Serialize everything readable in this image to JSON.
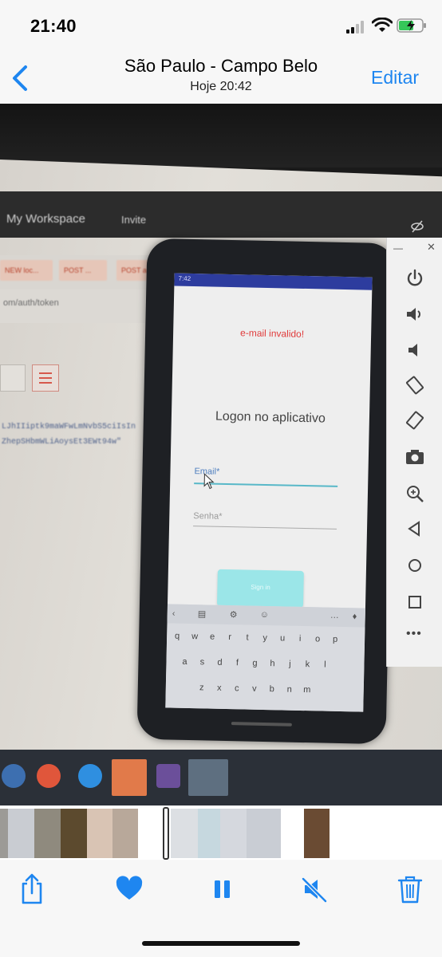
{
  "status_bar": {
    "time": "21:40"
  },
  "nav": {
    "title": "São Paulo - Campo Belo",
    "subtitle": "Hoje  20:42",
    "edit_label": "Editar"
  },
  "photo": {
    "postman": {
      "workspace_label": "My Workspace",
      "invite_label": "Invite",
      "tabs": [
        "NEW loc...",
        "POST ...",
        "POST a..."
      ],
      "url_text": "om/auth/token",
      "token_line_1": "LJhIIiptk9maWFwLmNvbS5ciIsIn",
      "token_line_2": "ZhepSHbmWLiAoysEt3EWt94w\""
    },
    "emulator_app": {
      "status_time": "7:42",
      "error_message": "e-mail invalido!",
      "heading": "Logon no aplicativo",
      "email_label": "Email*",
      "password_label": "Senha*",
      "signin_label": "Sign in",
      "keyboard_rows": [
        [
          "q",
          "w",
          "e",
          "r",
          "t",
          "y",
          "u",
          "i",
          "o",
          "p"
        ],
        [
          "a",
          "s",
          "d",
          "f",
          "g",
          "h",
          "j",
          "k",
          "l"
        ],
        [
          "z",
          "x",
          "c",
          "v",
          "b",
          "n",
          "m"
        ]
      ]
    }
  },
  "icons": {
    "back": "chevron-left-icon",
    "share": "share-icon",
    "favorite": "heart-icon",
    "pause": "pause-icon",
    "mute": "speaker-muted-icon",
    "trash": "trash-icon"
  },
  "colors": {
    "accent": "#1e86f0",
    "error": "#e03a3a",
    "app_bar": "#2d3c9e"
  }
}
